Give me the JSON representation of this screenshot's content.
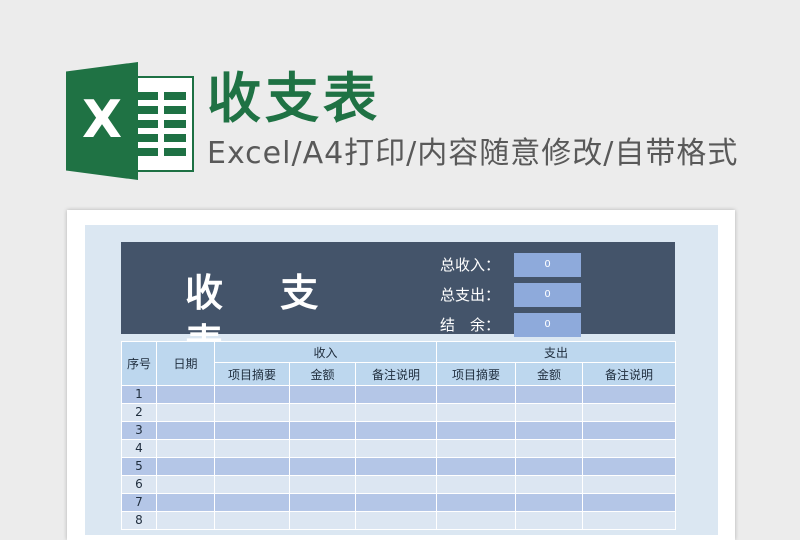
{
  "heading": {
    "title": "收支表",
    "subtitle": "Excel/A4打印/内容随意修改/自带格式"
  },
  "logo": {
    "letter": "X",
    "icon": "excel-icon",
    "brand_color": "#1f7244"
  },
  "sheet": {
    "title": "收 支 表",
    "summary": [
      {
        "label": "总收入：",
        "value": "0"
      },
      {
        "label": "总支出：",
        "value": "0"
      },
      {
        "label": "结　余：",
        "value": "0"
      }
    ],
    "header": {
      "seq": "序号",
      "date": "日期",
      "income": "收入",
      "expense": "支出",
      "income_cols": [
        "项目摘要",
        "金额",
        "备注说明"
      ],
      "expense_cols": [
        "项目摘要",
        "金额",
        "备注说明"
      ]
    },
    "rows": [
      "1",
      "2",
      "3",
      "4",
      "5",
      "6",
      "7",
      "8"
    ]
  },
  "colors": {
    "banner": "#44546a",
    "summary_box": "#8eaadb",
    "header_bg": "#bdd7ee",
    "row_dark": "#b4c6e7",
    "row_light": "#dce6f2"
  }
}
